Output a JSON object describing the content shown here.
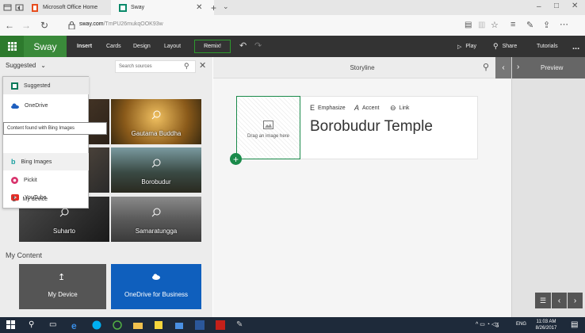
{
  "browser": {
    "tabs": [
      {
        "title": "Microsoft Office Home"
      },
      {
        "title": "Sway"
      }
    ],
    "url_domain": "sway.com",
    "url_path": "/TmPU26mukqOOK93w"
  },
  "app": {
    "name": "Sway",
    "menu": [
      "Insert",
      "Cards",
      "Design",
      "Layout"
    ],
    "remix_label": "Remix!",
    "play_label": "Play",
    "share_label": "Share",
    "tutorials_label": "Tutorials",
    "more_label": "..."
  },
  "left_pane": {
    "suggested_label": "Suggested",
    "search_placeholder": "Search sources",
    "dropdown": [
      {
        "label": "Suggested",
        "icon": "office-icon"
      },
      {
        "label": "OneDrive",
        "icon": "onedrive-icon"
      },
      {
        "label": "Bing Images",
        "icon": "bing-icon"
      },
      {
        "label": "Pickit",
        "icon": "pickit-icon"
      },
      {
        "label": "YouTube",
        "icon": "youtube-icon"
      },
      {
        "label": "My device",
        "icon": "upload-icon"
      }
    ],
    "tooltip": "Content found with Bing Images",
    "tiles": [
      "Gautama Buddha",
      "Borobudur",
      "Suharto",
      "Samaratungga"
    ],
    "my_content_label": "My Content",
    "my_device_label": "My Device",
    "onedrive_business_label": "OneDrive for Business"
  },
  "storyline": {
    "title": "Storyline",
    "preview_label": "Preview",
    "card": {
      "drag_label": "Drag an image here",
      "emphasize_label": "Emphasize",
      "accent_label": "Accent",
      "link_label": "Link",
      "heading": "Borobudur Temple"
    }
  },
  "taskbar": {
    "time": "11:03 AM",
    "date": "8/26/2017",
    "lang": "ENG"
  },
  "colors": {
    "accent_green": "#2e9a2e",
    "onedrive_blue": "#0f5fbd",
    "app_bar": "#333333"
  }
}
